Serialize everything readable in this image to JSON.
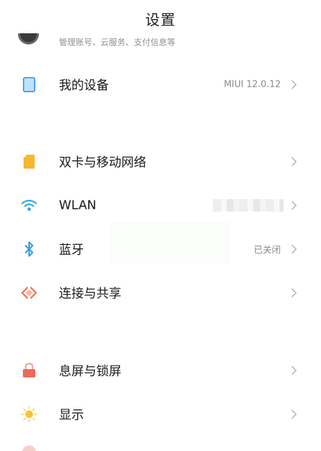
{
  "header": {
    "title": "设置"
  },
  "account": {
    "subtitle": "管理账号、云服务、支付信息等"
  },
  "sections": {
    "device": {
      "label": "我的设备",
      "value": "MIUI 12.0.12"
    },
    "sim": {
      "label": "双卡与移动网络"
    },
    "wlan": {
      "label": "WLAN"
    },
    "bluetooth": {
      "label": "蓝牙",
      "value": "已关闭"
    },
    "connection": {
      "label": "连接与共享"
    },
    "lockscreen": {
      "label": "息屏与锁屏"
    },
    "display": {
      "label": "显示"
    }
  },
  "colors": {
    "device_icon": "#4aa3f0",
    "sim_icon": "#f5b731",
    "wlan_icon": "#29a9e8",
    "bluetooth_icon": "#2f9be6",
    "connection_icon": "#f07a5a",
    "lock_icon": "#ec6a5c",
    "display_icon": "#f7c431"
  }
}
